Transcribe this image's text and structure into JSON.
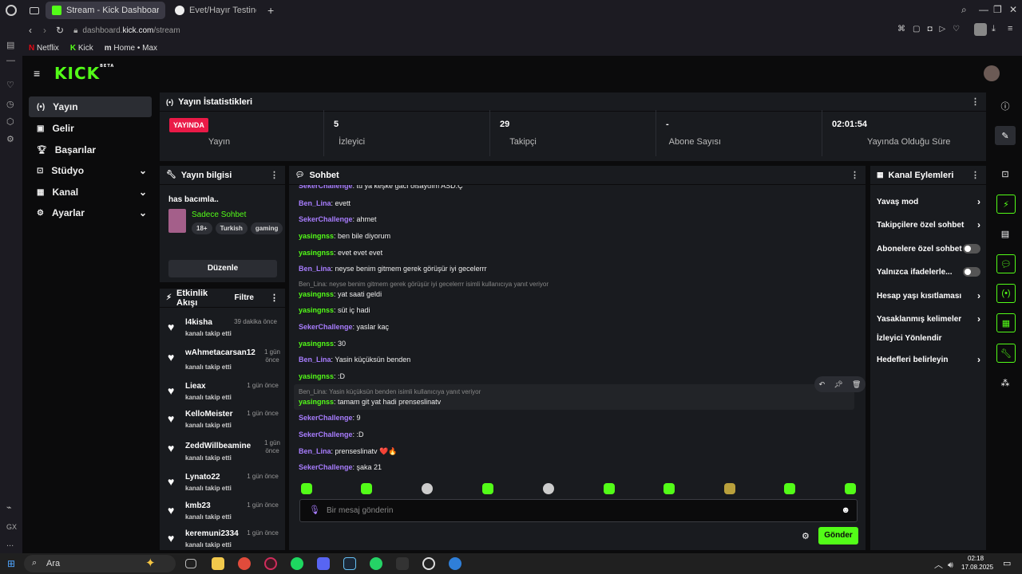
{
  "browser": {
    "tabs": [
      {
        "label": "Stream - Kick Dashboard"
      },
      {
        "label": "Evet/Hayır Testine Göre N"
      }
    ],
    "url_prefix": "dashboard.",
    "url_domain": "kick.com",
    "url_path": "/stream",
    "bookmarks": [
      {
        "label": "Netflix"
      },
      {
        "label": "Kick"
      },
      {
        "label": "Home • Max"
      }
    ],
    "left_strip": [
      "GX",
      "..."
    ]
  },
  "header": {
    "logo": "KICK",
    "beta": "BETA"
  },
  "nav": [
    {
      "label": "Yayın"
    },
    {
      "label": "Gelir"
    },
    {
      "label": "Başarılar"
    },
    {
      "label": "Stüdyo"
    },
    {
      "label": "Kanal"
    },
    {
      "label": "Ayarlar"
    }
  ],
  "stats": {
    "title": "Yayın İstatistikleri",
    "items": [
      {
        "value": "YAYINDA",
        "label": "Yayın"
      },
      {
        "value": "5",
        "label": "İzleyici"
      },
      {
        "value": "29",
        "label": "Takipçi"
      },
      {
        "value": "-",
        "label": "Abone Sayısı"
      },
      {
        "value": "02:01:54",
        "label": "Yayında Olduğu Süre"
      }
    ]
  },
  "stream_info": {
    "title": "Yayın bilgisi",
    "stream_title": "has bacımla..",
    "category": "Sadece Sohbet",
    "tags": [
      "18+",
      "Turkish",
      "gaming"
    ],
    "edit_button": "Düzenle"
  },
  "activity": {
    "title": "Etkinlik Akışı",
    "filter": "Filtre",
    "events": [
      {
        "name": "l4kisha",
        "sub": "kanalı takip etti",
        "time": "39 dakika önce"
      },
      {
        "name": "wAhmetacarsan12",
        "sub": "kanalı takip etti",
        "time": "1 gün önce"
      },
      {
        "name": "Lieax",
        "sub": "kanalı takip etti",
        "time": "1 gün önce"
      },
      {
        "name": "KelloMeister",
        "sub": "kanalı takip etti",
        "time": "1 gün önce"
      },
      {
        "name": "ZeddWillbeamine",
        "sub": "kanalı takip etti",
        "time": "1 gün önce"
      },
      {
        "name": "Lynato22",
        "sub": "kanalı takip etti",
        "time": "1 gün önce"
      },
      {
        "name": "kmb23",
        "sub": "kanalı takip etti",
        "time": "1 gün önce"
      },
      {
        "name": "keremuni2334",
        "sub": "kanalı takip etti",
        "time": "1 gün önce"
      }
    ]
  },
  "chat": {
    "title": "Sohbet",
    "messages": [
      {
        "user": "SekerChallenge",
        "text": ": tu ya keşke gacı olsaydım ASD.Ç"
      },
      {
        "user": "Ben_Lina",
        "text": ": evett"
      },
      {
        "user": "SekerChallenge",
        "text": ": ahmet"
      },
      {
        "user": "yasingnss",
        "text": ": ben bile diyorum"
      },
      {
        "user": "yasingnss",
        "text": ": evet evet evet"
      },
      {
        "user": "Ben_Lina",
        "text": ": neyse benim gitmem gerek görüşür iyi gecelerrr"
      },
      {
        "user": "yasingnss",
        "text": ": yat saati geldi"
      },
      {
        "user": "yasingnss",
        "text": ": süt iç hadi"
      },
      {
        "user": "SekerChallenge",
        "text": ": yaslar kaç"
      },
      {
        "user": "yasingnss",
        "text": ": 30"
      },
      {
        "user": "Ben_Lina",
        "text": ": Yasin küçüksün benden"
      },
      {
        "user": "yasingnss",
        "text": ": :D"
      },
      {
        "user": "yasingnss",
        "text": ": tamam git yat hadi prenseslinatv"
      },
      {
        "user": "SekerChallenge",
        "text": ": 9"
      },
      {
        "user": "SekerChallenge",
        "text": ": :D"
      },
      {
        "user": "Ben_Lina",
        "text": ": prenseslinatv ❤️🔥"
      },
      {
        "user": "SekerChallenge",
        "text": ": şaka 21"
      }
    ],
    "replies": [
      "Ben_Lina: neyse benim gitmem gerek görüşür iyi gecelerrr isimli kullanıcıya yanıt veriyor",
      "Ben_Lina: Yasin küçüksün benden isimli kullanıcıya yanıt veriyor"
    ],
    "input_placeholder": "Bir mesaj gönderin",
    "send_button": "Gönder"
  },
  "channel_actions": {
    "title": "Kanal Eylemleri",
    "items": [
      {
        "label": "Yavaş mod",
        "control": "arrow"
      },
      {
        "label": "Takipçilere özel sohbet",
        "control": "arrow"
      },
      {
        "label": "Abonelere özel sohbet",
        "control": "toggle"
      },
      {
        "label": "Yalnızca ifadelerle...",
        "control": "toggle"
      },
      {
        "label": "Hesap yaşı kısıtlaması",
        "control": "arrow"
      },
      {
        "label": "Yasaklanmış kelimeler",
        "control": "arrow"
      },
      {
        "label": "İzleyici Yönlendir",
        "control": "none"
      },
      {
        "label": "Hedefleri belirleyin",
        "control": "arrow"
      }
    ]
  },
  "taskbar": {
    "search": "Ara",
    "time": "02:18",
    "date": "17.08.2025"
  },
  "colors": {
    "accent": "#53fc18",
    "live": "#ea1a47",
    "user_purple": "#a87dfe",
    "user_green": "#53fc18"
  }
}
